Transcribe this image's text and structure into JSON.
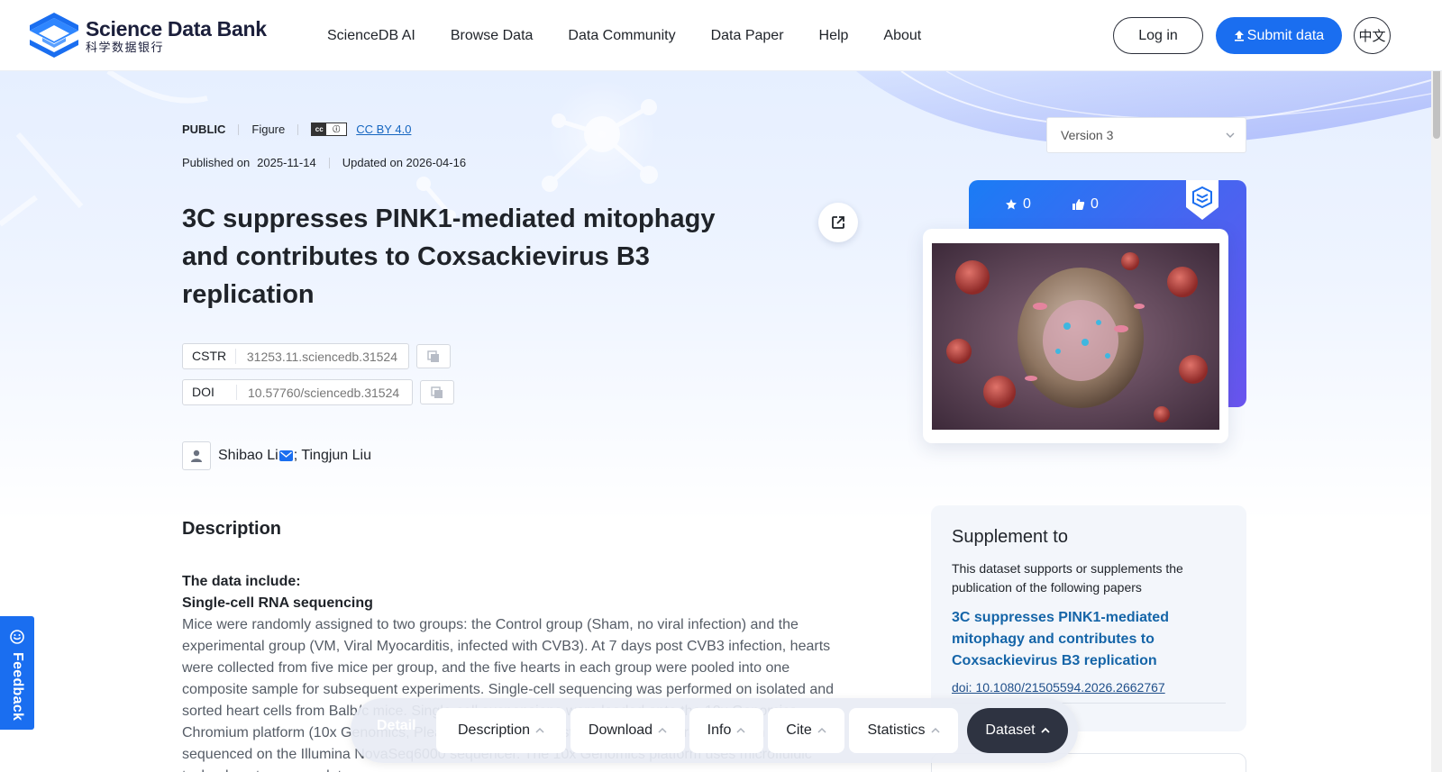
{
  "header": {
    "logo_en": "Science Data Bank",
    "logo_cn": "科学数据银行",
    "nav": [
      "ScienceDB AI",
      "Browse Data",
      "Data Community",
      "Data Paper",
      "Help",
      "About"
    ],
    "login": "Log in",
    "submit": "Submit data",
    "lang": "中文"
  },
  "meta": {
    "access": "PUBLIC",
    "type": "Figure",
    "license": "CC BY 4.0",
    "published_label": "Published on",
    "published_date": "2025-11-14",
    "updated": "Updated on 2026-04-16"
  },
  "dataset": {
    "title": "3C suppresses PINK1-mediated mitophagy and contributes to Coxsackievirus B3 replication",
    "cstr_label": "CSTR",
    "cstr": "31253.11.sciencedb.31524",
    "doi_label": "DOI",
    "doi": "10.57760/sciencedb.31524",
    "author1": "Shibao Li",
    "author2": "; Tingjun Liu"
  },
  "description": {
    "heading": "Description",
    "line1": "The data include:",
    "line2": "Single-cell RNA sequencing",
    "body": "Mice were randomly assigned to two groups: the Control group (Sham, no viral infection) and the experimental group (VM, Viral Myocarditis, infected with CVB3). At 7 days post CVB3 infection, hearts were collected from five mice per group, and the five hearts in each group were pooled into one composite sample for subsequent experiments. Single-cell sequencing was performed on isolated and sorted heart cells from Balb/c mice. Single-cell suspensions were loaded onto the 10x Genomics Chromium platform (10x Genomics, Pleasanton, CA) to construct single-cell libraries, which were sequenced on the Illumina NovaSeq6000 sequencer. The 10x Genomics platform uses microfluidic technology to encapsulate"
  },
  "sidebar": {
    "version": "Version 3",
    "stars": "0",
    "likes": "0",
    "supplement_heading": "Supplement to",
    "supplement_sub": "This dataset supports or supplements the publication of the following papers",
    "paper_title": "3C suppresses PINK1-mediated mitophagy and contributes to Coxsackievirus B3 replication",
    "paper_doi": "doi: 10.1080/21505594.2026.2662767"
  },
  "feedback": "Feedback",
  "tabbar": {
    "detail": "Detail",
    "tabs": [
      "Description",
      "Download",
      "Info",
      "Cite",
      "Statistics",
      "Dataset"
    ]
  },
  "colors": {
    "brand_blue": "#1a6ef0",
    "dark_tab": "#2e3341",
    "link_blue": "#1565a8"
  }
}
